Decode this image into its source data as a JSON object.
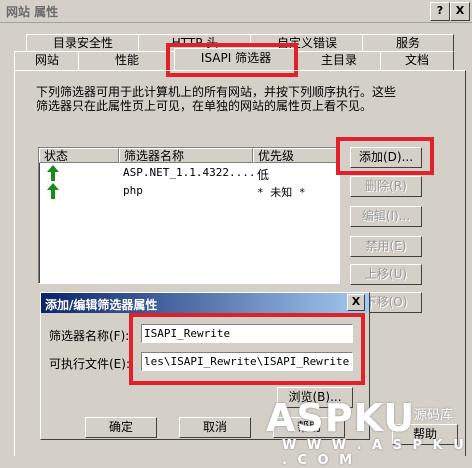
{
  "window": {
    "title": "网站 属性",
    "help_btn": "?",
    "close_btn": "X"
  },
  "tabs": {
    "row1": [
      "目录安全性",
      "HTTP 头",
      "自定义错误",
      "服务"
    ],
    "row2": [
      "网站",
      "性能",
      "ISAPI 筛选器",
      "主目录",
      "文档"
    ],
    "active": "ISAPI 筛选器"
  },
  "description": "下列筛选器可用于此计算机上的所有网站，并按下列顺序执行。这些筛选器只在此属性页上可见，在单独的网站的属性页上看不见。",
  "list": {
    "columns": [
      "状态",
      "筛选器名称",
      "优先级"
    ],
    "rows": [
      {
        "status_icon": "green-up-arrow-icon",
        "name": "ASP.NET_1.1.4322....",
        "priority": "低"
      },
      {
        "status_icon": "green-up-arrow-icon",
        "name": "php",
        "priority": "* 未知 *"
      }
    ]
  },
  "buttons": {
    "add": "添加(D)...",
    "remove": "删除(R)",
    "edit": "编辑(I)...",
    "disable": "禁用(E)",
    "move_up": "上移(U)",
    "move_down": "下移(O)",
    "help": "帮助"
  },
  "dialog": {
    "title": "添加/编辑筛选器属性",
    "close_btn": "X",
    "filter_name_label": "筛选器名称(F):",
    "filter_name_value": "ISAPI_Rewrite",
    "exe_label": "可执行文件(E):",
    "exe_value": "les\\ISAPI_Rewrite\\ISAPI_Rewrite.dll",
    "browse": "浏览(B)...",
    "ok": "确定",
    "cancel": "取消",
    "help": "帮助"
  },
  "watermark": {
    "brand": "ASPKU",
    "sub": "源码库",
    "url": "W W W . A S P K U . C O M"
  },
  "colors": {
    "highlight_red": "#e0202a",
    "dialog_title_blue": "#0a246a",
    "arrow_green": "#1a8a1a"
  }
}
